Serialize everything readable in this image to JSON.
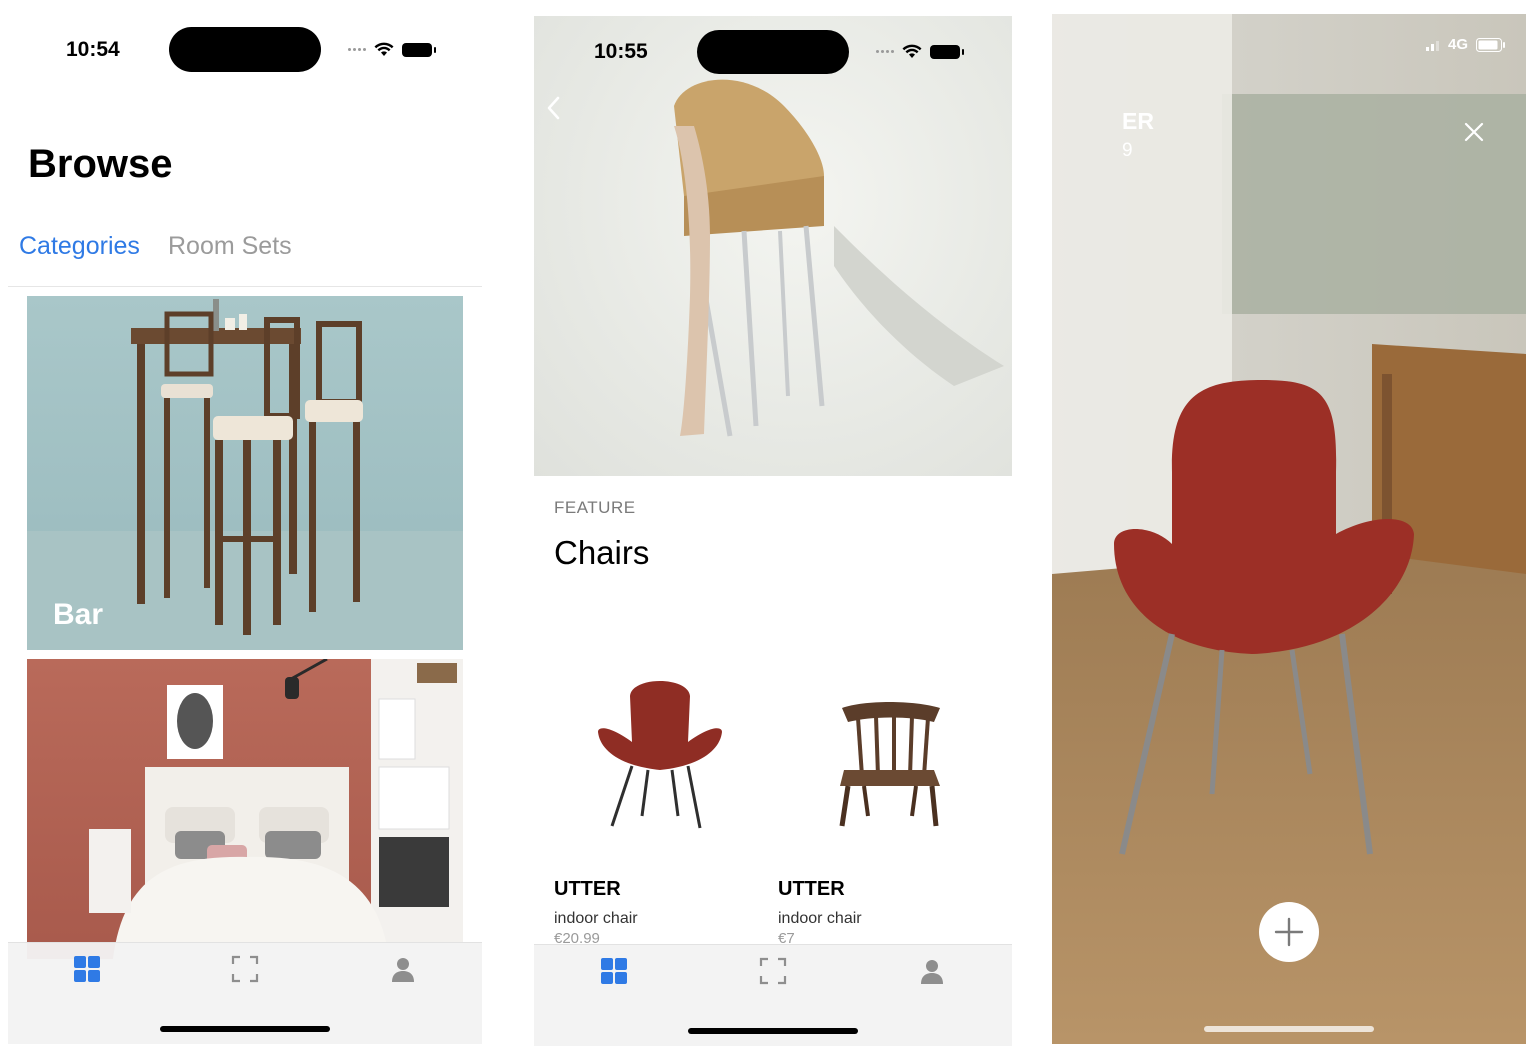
{
  "screen1": {
    "status": {
      "time": "10:54"
    },
    "title": "Browse",
    "segments": [
      {
        "label": "Categories"
      },
      {
        "label": "Room Sets"
      }
    ],
    "cards": [
      {
        "label": "Bar"
      },
      {
        "label": ""
      }
    ],
    "tabbar": {
      "items": [
        "grid-icon",
        "scan-icon",
        "person-icon"
      ],
      "active_color": "#2f7ae5"
    }
  },
  "screen2": {
    "status": {
      "time": "10:55"
    },
    "kicker": "FEATURE",
    "title": "Chairs",
    "products": [
      {
        "name": "UTTER",
        "type": "indoor chair",
        "price": "€20.99"
      },
      {
        "name": "UTTER",
        "type": "indoor chair",
        "price": "€7"
      }
    ]
  },
  "screen3": {
    "status": {
      "network": "4G"
    },
    "product_name": "ER",
    "product_price": "9"
  },
  "colors": {
    "accent": "#2f7ae5",
    "chair_red": "#9c2f26"
  }
}
